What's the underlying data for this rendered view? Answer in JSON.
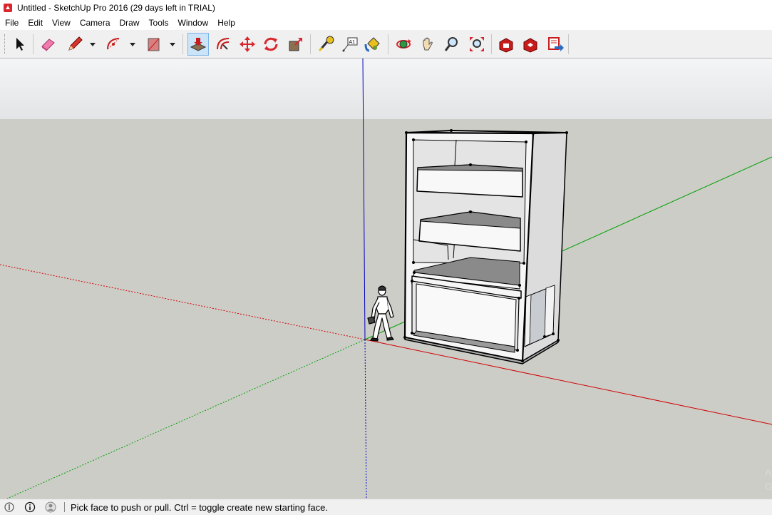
{
  "window": {
    "title": "Untitled - SketchUp Pro 2016 (29 days left in TRIAL)"
  },
  "menu": [
    "File",
    "Edit",
    "View",
    "Camera",
    "Draw",
    "Tools",
    "Window",
    "Help"
  ],
  "toolbar": {
    "tools": [
      {
        "name": "select",
        "icon": "arrow-cursor-icon"
      },
      {
        "name": "eraser",
        "icon": "eraser-icon"
      },
      {
        "name": "line",
        "icon": "pencil-icon"
      },
      {
        "name": "arc",
        "icon": "arc-icon"
      },
      {
        "name": "rectangle",
        "icon": "rectangle-icon"
      },
      {
        "name": "push-pull",
        "icon": "push-pull-icon",
        "active": true
      },
      {
        "name": "offset",
        "icon": "offset-icon"
      },
      {
        "name": "move",
        "icon": "move-icon"
      },
      {
        "name": "rotate",
        "icon": "rotate-icon"
      },
      {
        "name": "scale",
        "icon": "scale-icon"
      },
      {
        "name": "tape-measure",
        "icon": "tape-measure-icon"
      },
      {
        "name": "text",
        "icon": "text-tool-icon"
      },
      {
        "name": "paint-bucket",
        "icon": "paint-bucket-icon"
      },
      {
        "name": "orbit",
        "icon": "orbit-icon"
      },
      {
        "name": "pan",
        "icon": "pan-hand-icon"
      },
      {
        "name": "zoom",
        "icon": "zoom-icon"
      },
      {
        "name": "zoom-extents",
        "icon": "zoom-extents-icon"
      },
      {
        "name": "3d-warehouse",
        "icon": "warehouse-icon"
      },
      {
        "name": "extension-warehouse",
        "icon": "extension-warehouse-icon"
      },
      {
        "name": "layout",
        "icon": "send-to-layout-icon"
      }
    ]
  },
  "colors": {
    "sky": "#e8eaec",
    "ground": "#cdcdc8",
    "axis_red": "#d00000",
    "axis_green": "#00a000",
    "axis_blue": "#0000c0",
    "model_face": "#f4f4f4",
    "model_shadow": "#8a8a8a"
  },
  "statusbar": {
    "message": "Pick face to push or pull.  Ctrl = toggle create new starting face."
  },
  "watermark": "A G"
}
